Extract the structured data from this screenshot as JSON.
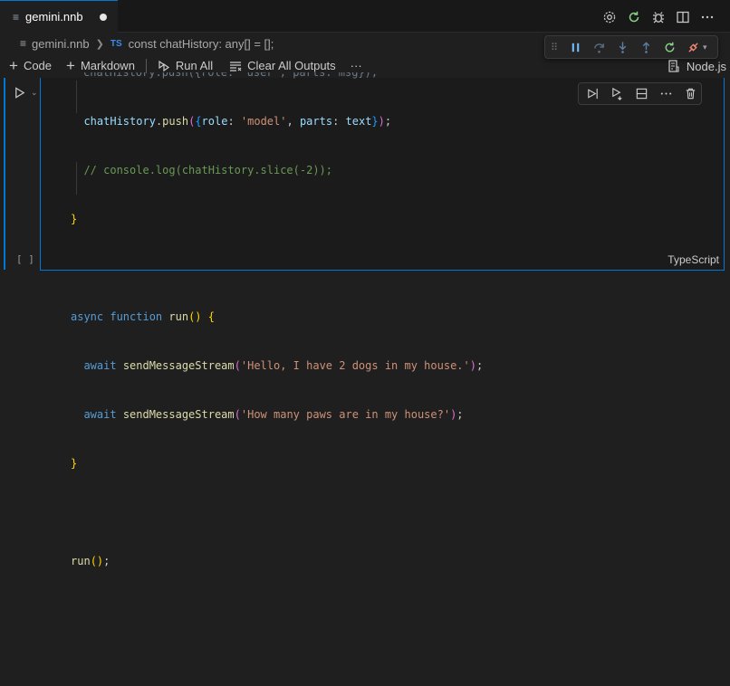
{
  "tab": {
    "icon": "notebook-icon",
    "label": "gemini.nnb",
    "dirty": true
  },
  "tab_actions": [
    "gear-icon",
    "restart-icon",
    "bug-icon",
    "split-editor-icon",
    "more-icon"
  ],
  "breadcrumb": {
    "file": "gemini.nnb",
    "ts_badge": "TS",
    "symbol": "const chatHistory: any[] = [];"
  },
  "debug_toolbar": [
    "drag-grip-icon",
    "pause-icon",
    "step-over-icon",
    "step-into-icon",
    "step-out-icon",
    "restart-icon",
    "disconnect-icon",
    "chevron-down-icon"
  ],
  "toolbar": {
    "code_label": "Code",
    "markdown_label": "Markdown",
    "run_all_label": "Run All",
    "clear_outputs_label": "Clear All Outputs",
    "more_label": "···",
    "kernel_label": "Node.js"
  },
  "cell": {
    "count": "[ ]",
    "language": "TypeScript",
    "clipped_line": "chatHistory.push({role: 'user', parts: msg});",
    "actions": [
      "execute-above-icon",
      "execute-below-icon",
      "split-cell-icon",
      "more-icon",
      "delete-icon"
    ],
    "code": {
      "l1": {
        "a": "chatHistory",
        "b": ".",
        "c": "push",
        "d": "(",
        "e": "{",
        "f": "role",
        "g": ": ",
        "h": "'model'",
        "i": ", ",
        "j": "parts",
        "k": ": ",
        "l": "text",
        "m": "}",
        "n": ")",
        "o": ";"
      },
      "l2": "// console.log(chatHistory.slice(-2));",
      "l3": "}",
      "l5": {
        "a": "async",
        "b": " ",
        "c": "function",
        "d": " ",
        "e": "run",
        "f": "()",
        "g": " ",
        "h": "{"
      },
      "l6": {
        "a": "await",
        "b": " ",
        "c": "sendMessageStream",
        "d": "(",
        "e": "'Hello, I have 2 dogs in my house.'",
        "f": ")",
        "g": ";"
      },
      "l7": {
        "a": "await",
        "b": " ",
        "c": "sendMessageStream",
        "d": "(",
        "e": "'How many paws are in my house?'",
        "f": ")",
        "g": ";"
      },
      "l8": "}",
      "l10": {
        "a": "run",
        "b": "()",
        "c": ";"
      }
    }
  }
}
